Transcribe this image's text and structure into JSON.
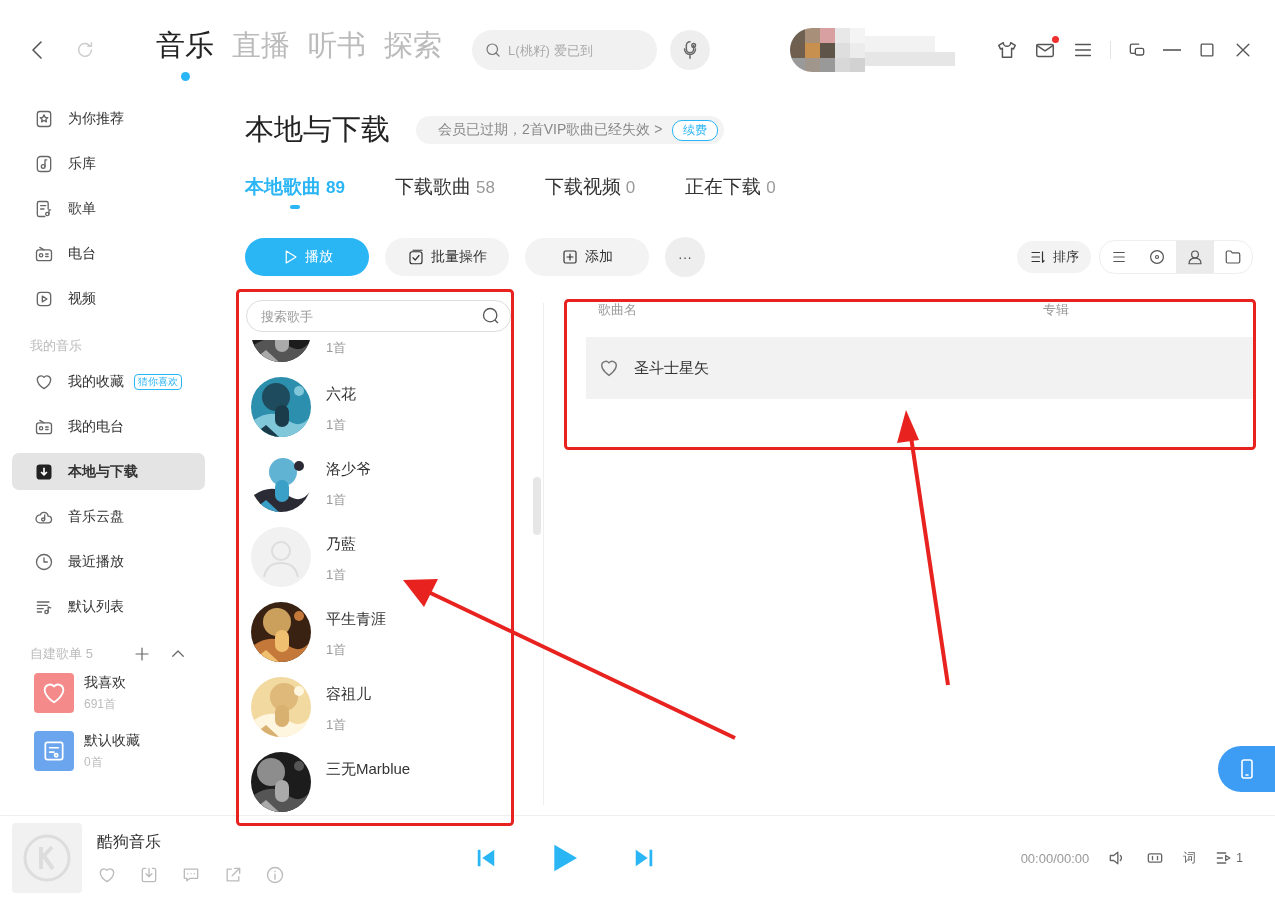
{
  "nav": {
    "tabs": [
      {
        "label": "音乐",
        "selected": true
      },
      {
        "label": "直播",
        "selected": false
      },
      {
        "label": "听书",
        "selected": false
      },
      {
        "label": "探索",
        "selected": false
      }
    ],
    "search": {
      "placeholder": "L(桃籽) 爱已到"
    },
    "mail_unread": true
  },
  "sidebar": {
    "items": [
      {
        "label": "为你推荐",
        "kind": "star",
        "selected": false
      },
      {
        "label": "乐库",
        "kind": "library",
        "selected": false
      },
      {
        "label": "歌单",
        "kind": "playlist",
        "selected": false
      },
      {
        "label": "电台",
        "kind": "radio",
        "selected": false
      },
      {
        "label": "视频",
        "kind": "video",
        "selected": false
      }
    ],
    "my_music": {
      "title": "我的音乐",
      "items": [
        {
          "label": "我的收藏",
          "kind": "heart",
          "selected": false,
          "badge": "猜你喜欢"
        },
        {
          "label": "我的电台",
          "kind": "radio",
          "selected": false
        },
        {
          "label": "本地与下载",
          "kind": "download",
          "selected": true
        },
        {
          "label": "音乐云盘",
          "kind": "cloud",
          "selected": false
        },
        {
          "label": "最近播放",
          "kind": "clock",
          "selected": false
        },
        {
          "label": "默认列表",
          "kind": "list",
          "selected": false
        }
      ]
    },
    "playlists": {
      "title": "自建歌单",
      "count": "5",
      "items": [
        {
          "name": "我喜欢",
          "count": "691首",
          "kind": "liked"
        },
        {
          "name": "默认收藏",
          "count": "0首",
          "kind": "default"
        }
      ]
    }
  },
  "main": {
    "title": "本地与下载",
    "notice": {
      "text": "会员已过期，2首VIP歌曲已经失效 >",
      "action": "续费"
    },
    "tabs": [
      {
        "label": "本地歌曲",
        "count": "89",
        "selected": true
      },
      {
        "label": "下载歌曲",
        "count": "58",
        "selected": false
      },
      {
        "label": "下载视频",
        "count": "0",
        "selected": false
      },
      {
        "label": "正在下载",
        "count": "0",
        "selected": false
      }
    ],
    "toolbar": {
      "play": "播放",
      "batch": "批量操作",
      "add": "添加",
      "more": "···",
      "sort": "排序",
      "views": [
        {
          "kind": "list",
          "selected": false
        },
        {
          "kind": "disc",
          "selected": false
        },
        {
          "kind": "artist",
          "selected": true
        },
        {
          "kind": "folder",
          "selected": false
        }
      ]
    },
    "artist_pane": {
      "search_placeholder": "搜索歌手",
      "artists": [
        {
          "count": "1首",
          "kind": "picture"
        },
        {
          "name": "六花",
          "count": "1首",
          "kind": "picture"
        },
        {
          "name": "洛少爷",
          "count": "1首",
          "kind": "picture"
        },
        {
          "name": "乃藍",
          "count": "1首",
          "kind": "default"
        },
        {
          "name": "平生青涯",
          "count": "1首",
          "kind": "picture"
        },
        {
          "name": "容祖儿",
          "count": "1首",
          "kind": "picture"
        },
        {
          "name": "三无Marblue",
          "kind": "picture"
        }
      ]
    },
    "songs": {
      "columns": [
        "歌曲名",
        "专辑"
      ],
      "rows": [
        {
          "title": "圣斗士星矢",
          "liked": false,
          "selected": true
        }
      ]
    }
  },
  "player": {
    "title": "酷狗音乐",
    "time": "00:00/00:00",
    "lyrics": "词",
    "queue_count": "1"
  }
}
